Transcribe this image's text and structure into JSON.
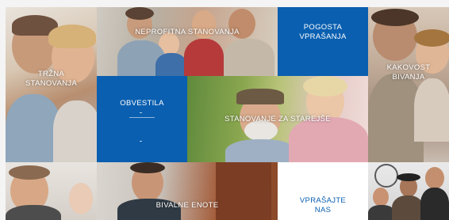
{
  "tiles": {
    "trzna": {
      "line1": "TRŽNA",
      "line2": "STANOVANJA"
    },
    "neprofitna": {
      "line1": "NEPROFITNA STANOVANJA"
    },
    "pogosta": {
      "line1": "POGOSTA",
      "line2": "VPRAŠANJA"
    },
    "kakovost": {
      "line1": "KAKOVOST",
      "line2": "BIVANJA"
    },
    "obvestila": {
      "line1": "OBVESTILA"
    },
    "starejse": {
      "line1": "STANOVANJE ZA STAREJŠE"
    },
    "bivalne": {
      "line1": "BIVALNE ENOTE"
    },
    "vprasajte": {
      "line1": "VPRAŠAJTE",
      "line2": "NAS"
    }
  },
  "colors": {
    "accent_blue": "#0a5fb0",
    "white_tile": "#ffffff"
  }
}
